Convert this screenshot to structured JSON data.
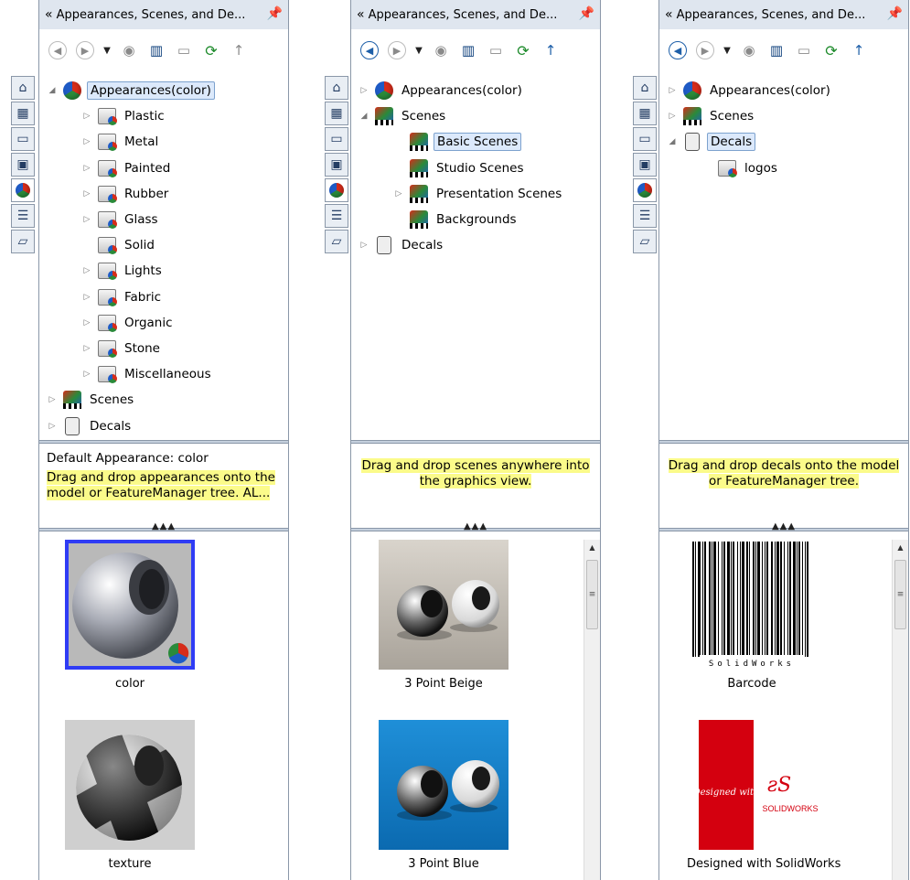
{
  "panels": [
    {
      "title": "Appearances, Scenes, and De...",
      "default_line": "Default Appearance: color",
      "message": "Drag and drop appearances onto the model or FeatureManager tree.  AL...",
      "tree": [
        {
          "label": "Appearances(color)",
          "level": 0,
          "icon": "appearance-ball-icon",
          "expander": "expanded",
          "selected": true
        },
        {
          "label": "Plastic",
          "level": 1,
          "icon": "appearance-folder-icon",
          "expander": "collapsed"
        },
        {
          "label": "Metal",
          "level": 1,
          "icon": "appearance-folder-icon",
          "expander": "collapsed"
        },
        {
          "label": "Painted",
          "level": 1,
          "icon": "appearance-folder-icon",
          "expander": "collapsed"
        },
        {
          "label": "Rubber",
          "level": 1,
          "icon": "appearance-folder-icon",
          "expander": "collapsed"
        },
        {
          "label": "Glass",
          "level": 1,
          "icon": "appearance-folder-icon",
          "expander": "collapsed"
        },
        {
          "label": "Solid",
          "level": 1,
          "icon": "appearance-folder-icon",
          "expander": "none"
        },
        {
          "label": "Lights",
          "level": 1,
          "icon": "appearance-folder-icon",
          "expander": "collapsed"
        },
        {
          "label": "Fabric",
          "level": 1,
          "icon": "appearance-folder-icon",
          "expander": "collapsed"
        },
        {
          "label": "Organic",
          "level": 1,
          "icon": "appearance-folder-icon",
          "expander": "collapsed"
        },
        {
          "label": "Stone",
          "level": 1,
          "icon": "appearance-folder-icon",
          "expander": "collapsed"
        },
        {
          "label": "Miscellaneous",
          "level": 1,
          "icon": "appearance-folder-icon",
          "expander": "collapsed"
        },
        {
          "label": "Scenes",
          "level": 0,
          "icon": "scenes-icon",
          "expander": "collapsed"
        },
        {
          "label": "Decals",
          "level": 0,
          "icon": "decals-icon",
          "expander": "collapsed"
        }
      ],
      "gallery": [
        {
          "caption": "color",
          "image": "glossy-gray-sphere-thumbnail",
          "selected": true
        },
        {
          "caption": "texture",
          "image": "checkered-sphere-thumbnail"
        }
      ]
    },
    {
      "title": "Appearances, Scenes, and De...",
      "message": "Drag and drop scenes anywhere into the graphics view.",
      "tree": [
        {
          "label": "Appearances(color)",
          "level": 0,
          "icon": "appearance-ball-icon",
          "expander": "collapsed"
        },
        {
          "label": "Scenes",
          "level": 0,
          "icon": "scenes-icon",
          "expander": "expanded"
        },
        {
          "label": "Basic Scenes",
          "level": 1,
          "icon": "scene-folder-icon",
          "expander": "none",
          "selected": true
        },
        {
          "label": "Studio Scenes",
          "level": 1,
          "icon": "scene-folder-icon",
          "expander": "none"
        },
        {
          "label": "Presentation Scenes",
          "level": 1,
          "icon": "scene-folder-icon",
          "expander": "collapsed"
        },
        {
          "label": "Backgrounds",
          "level": 1,
          "icon": "scene-folder-icon",
          "expander": "none"
        },
        {
          "label": "Decals",
          "level": 0,
          "icon": "decals-icon",
          "expander": "collapsed"
        }
      ],
      "gallery": [
        {
          "caption": "3 Point Beige",
          "image": "beige-scene-thumbnail"
        },
        {
          "caption": "3 Point Blue",
          "image": "blue-scene-thumbnail"
        }
      ]
    },
    {
      "title": "Appearances, Scenes, and De...",
      "message": "Drag and drop decals onto the model or FeatureManager tree.",
      "tree": [
        {
          "label": "Appearances(color)",
          "level": 0,
          "icon": "appearance-ball-icon",
          "expander": "collapsed"
        },
        {
          "label": "Scenes",
          "level": 0,
          "icon": "scenes-icon",
          "expander": "collapsed"
        },
        {
          "label": "Decals",
          "level": 0,
          "icon": "decals-icon",
          "expander": "expanded",
          "selected": true
        },
        {
          "label": "logos",
          "level": 1,
          "icon": "decal-folder-icon",
          "expander": "none"
        }
      ],
      "gallery": [
        {
          "caption": "Barcode",
          "image": "barcode-thumbnail"
        },
        {
          "caption": "Designed with SolidWorks",
          "image": "solidworks-logo-thumbnail"
        }
      ]
    }
  ],
  "barcode_text": "SolidWorks",
  "logo_text_left": "Designed with",
  "logo_text_right": "SOLIDWORKS",
  "logo_mark": "ƨS",
  "sidebar_icons": [
    "home-icon",
    "parts-icon",
    "folder-icon",
    "design-library-icon",
    "appearances-icon",
    "properties-icon",
    "forum-icon"
  ],
  "active_sidebar_icon": "appearances-icon",
  "colors": {
    "highlight": "#fbfb8a",
    "selection": "#dce9fb",
    "titlebar": "#dfe6ef",
    "accent_selected_border": "#2f3cf5"
  }
}
